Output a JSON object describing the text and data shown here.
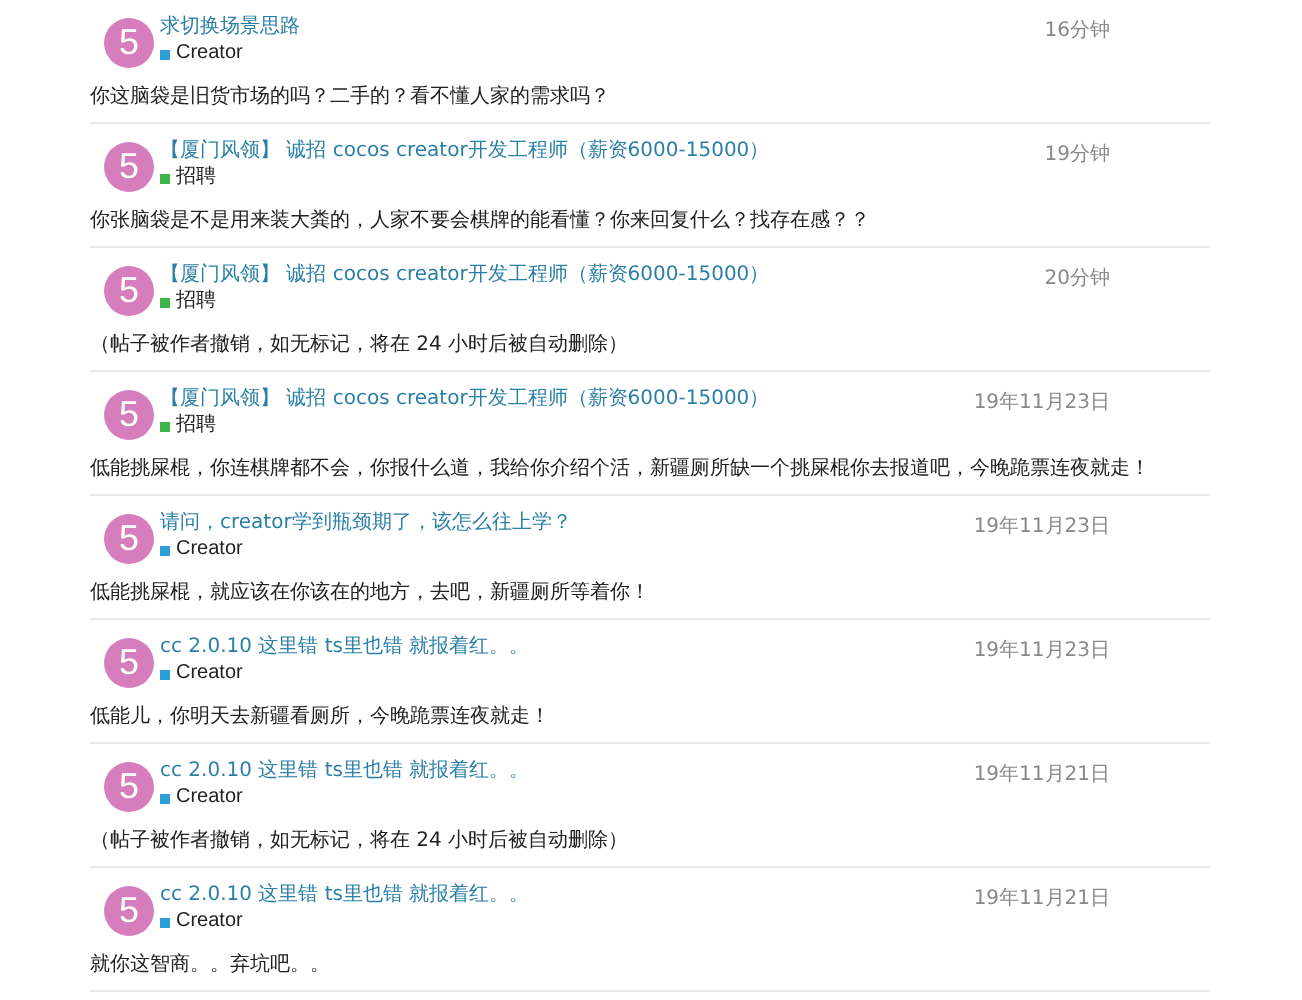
{
  "posts": [
    {
      "avatar": "5",
      "title": "求切换场景思路",
      "category": {
        "name": "Creator",
        "color": "#2d9fd8"
      },
      "time": "16分钟",
      "body": "你这脑袋是旧货市场的吗？二手的？看不懂人家的需求吗？"
    },
    {
      "avatar": "5",
      "title": "【厦门风领】 诚招 cocos creator开发工程师（薪资6000-15000）",
      "category": {
        "name": "招聘",
        "color": "#3db54a"
      },
      "time": "19分钟",
      "body": "你张脑袋是不是用来装大粪的，人家不要会棋牌的能看懂？你来回复什么？找存在感？？"
    },
    {
      "avatar": "5",
      "title": "【厦门风领】 诚招 cocos creator开发工程师（薪资6000-15000）",
      "category": {
        "name": "招聘",
        "color": "#3db54a"
      },
      "time": "20分钟",
      "body": "（帖子被作者撤销，如无标记，将在 24 小时后被自动删除）"
    },
    {
      "avatar": "5",
      "title": "【厦门风领】 诚招 cocos creator开发工程师（薪资6000-15000）",
      "category": {
        "name": "招聘",
        "color": "#3db54a"
      },
      "time": "19年11月23日",
      "body": "低能挑屎棍，你连棋牌都不会，你报什么道，我给你介绍个活，新疆厕所缺一个挑屎棍你去报道吧，今晚跪票连夜就走！"
    },
    {
      "avatar": "5",
      "title": "请问，creator学到瓶颈期了，该怎么往上学？",
      "category": {
        "name": "Creator",
        "color": "#2d9fd8"
      },
      "time": "19年11月23日",
      "body": "低能挑屎棍，就应该在你该在的地方，去吧，新疆厕所等着你！"
    },
    {
      "avatar": "5",
      "title": "cc 2.0.10 这里错 ts里也错 就报着红。。",
      "category": {
        "name": "Creator",
        "color": "#2d9fd8"
      },
      "time": "19年11月23日",
      "body": "低能儿，你明天去新疆看厕所，今晚跪票连夜就走！"
    },
    {
      "avatar": "5",
      "title": "cc 2.0.10 这里错 ts里也错 就报着红。。",
      "category": {
        "name": "Creator",
        "color": "#2d9fd8"
      },
      "time": "19年11月21日",
      "body": "（帖子被作者撤销，如无标记，将在 24 小时后被自动删除）"
    },
    {
      "avatar": "5",
      "title": "cc 2.0.10 这里错 ts里也错 就报着红。。",
      "category": {
        "name": "Creator",
        "color": "#2d9fd8"
      },
      "time": "19年11月21日",
      "body": "就你这智商。。弃坑吧。。"
    }
  ]
}
